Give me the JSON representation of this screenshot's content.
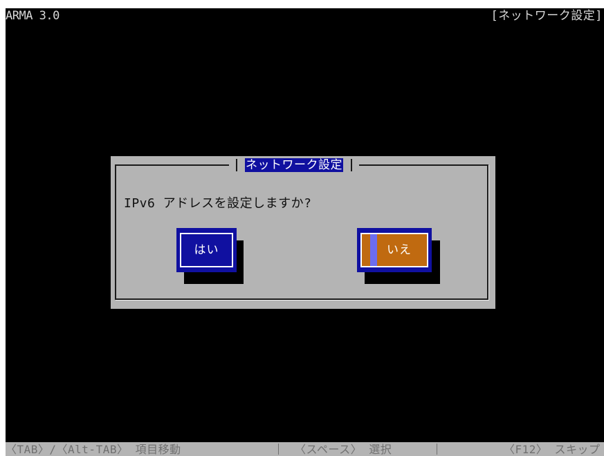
{
  "header": {
    "app_title": "ARMA 3.0",
    "screen_title": "[ネットワーク設定]"
  },
  "dialog": {
    "title": "ネットワーク設定",
    "message": "IPv6 アドレスを設定しますか?",
    "yes_label": "はい",
    "no_label": "いいえ",
    "no_label_visible": "いえ",
    "focused_button": "no"
  },
  "statusbar": {
    "item_1": "〈TAB〉/〈Alt-TAB〉 項目移動",
    "item_2": "〈スペース〉 選択",
    "item_3": "〈F12〉 スキップ"
  },
  "colors": {
    "screen_bg": "#000000",
    "dialog_bg": "#b4b4b4",
    "button_bg": "#1010a0",
    "focus_fill": "#c06a10",
    "cursor": "#6c6cf0"
  }
}
